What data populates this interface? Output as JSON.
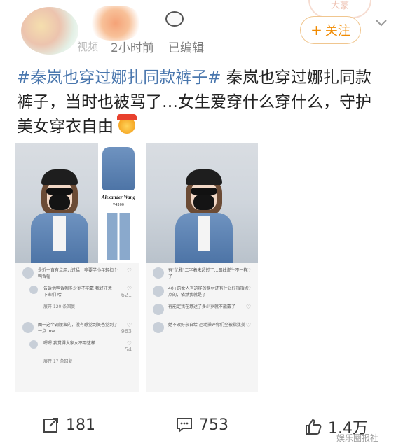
{
  "header": {
    "username": "视频",
    "time": "2小时前",
    "edit_status": "已编辑",
    "follow_label": "关注",
    "badge_text": "大蒙"
  },
  "post": {
    "hashtag": "#秦岚也穿过娜扎同款裤子#",
    "body": " 秦岚也穿过娜扎同款裤子，当时也被骂了…女生爱穿什么穿什么，守护美女穿衣自由"
  },
  "images": {
    "left": {
      "brand": "Alexander Wang",
      "price": "¥4300",
      "comments": [
        {
          "text": "是近一直有点用力过猛，非要学小年轻扣个",
          "sub": "鸭舌帽",
          "likes": "",
          "reply": false
        },
        {
          "text": "告诉他鸭舌帽多少岁不能戴 我好注意",
          "sub": "下辈们 哈",
          "likes": "621",
          "reply": true
        },
        {
          "text": "展开 120 条回复",
          "sub": "",
          "likes": "",
          "reply": true,
          "more": true
        },
        {
          "text": "图一这个调腰蛮的，没有感觉到美爸觉到了",
          "sub": "一点 low",
          "likes": "963",
          "reply": false
        },
        {
          "text": "嗯嗯 我觉得大家女不用这样",
          "sub": "",
          "likes": "54",
          "reply": true
        },
        {
          "text": "展开 17 条回复",
          "sub": "",
          "likes": "",
          "reply": true,
          "more": true
        }
      ]
    },
    "right": {
      "comments": [
        {
          "text": "有\"优雅\"二字着未超过了…跟线说生不一样",
          "sub": "了",
          "likes": "",
          "reply": false
        },
        {
          "text": "40+的女人有这样的身材还有什么好指指点",
          "sub": "点的，依然我就是了",
          "likes": "",
          "reply": false
        },
        {
          "text": "有能定我在意述了多少岁就不能戴了",
          "sub": "",
          "likes": "",
          "reply": false
        },
        {
          "text": "她不改好亲自给 运动操评你们全被指数美",
          "sub": "",
          "likes": "",
          "reply": false
        }
      ]
    }
  },
  "actions": {
    "forward_count": "181",
    "comment_count": "753",
    "like_count": "1.4万"
  },
  "watermark": "娱乐圈报社",
  "colors": {
    "hashtag": "#4a77ae",
    "follow": "#f08a00",
    "meta": "#7f7f7f"
  }
}
